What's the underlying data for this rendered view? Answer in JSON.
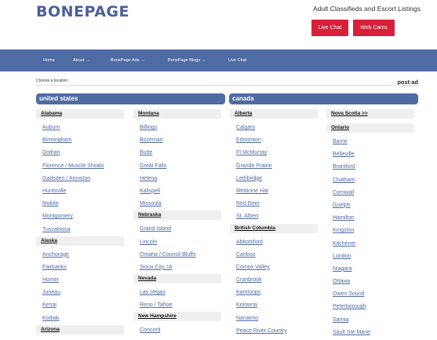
{
  "header": {
    "logo_text": "BONEPAGE",
    "tagline": "Adult Classifieds and Escort Listings",
    "live_chat_button": "Live Chat",
    "web_cams_button": "Web Cams"
  },
  "nav": {
    "items": [
      {
        "label": "Home",
        "dropdown": false
      },
      {
        "label": "About",
        "dropdown": true
      },
      {
        "label": "BonePage Ads",
        "dropdown": true
      },
      {
        "label": "BonePage Blogs",
        "dropdown": true
      },
      {
        "label": "Live Chat",
        "dropdown": false
      }
    ]
  },
  "location": {
    "choose_label": "Choose a location:",
    "post_ad": "post ad"
  },
  "countries": {
    "us": "united states",
    "canada": "canada"
  },
  "columns": [
    [
      {
        "region": "Alabama",
        "cities": [
          "Auburn",
          "Birmingham",
          "Dothan",
          "Florence / Muscle Shoals",
          "Gadsden / Anniston",
          "Huntsville",
          "Mobile",
          "Montgomery",
          "Tuscaloosa"
        ]
      },
      {
        "region": "Alaska",
        "cities": [
          "Anchorage",
          "Fairbanks",
          "Homer",
          "Juneau",
          "Kenai",
          "Kodiak"
        ]
      },
      {
        "region": "Arizona",
        "cities": []
      }
    ],
    [
      {
        "region": "Montana",
        "cities": [
          "Billings",
          "Bozeman",
          "Butte",
          "Great Falls",
          "Helena",
          "Kalispell",
          "Missoula"
        ]
      },
      {
        "region": "Nebraska",
        "cities": [
          "Grand Island",
          "Lincoln",
          "Omaha / Council Bluffs",
          "Sioux City, IA"
        ]
      },
      {
        "region": "Nevada",
        "cities": [
          "Las Vegas",
          "Reno / Tahoe"
        ]
      },
      {
        "region": "New Hampshire",
        "cities": [
          "Concord"
        ]
      }
    ],
    [
      {
        "region": "Alberta",
        "cities": [
          "Calgary",
          "Edmonton",
          "Ft McMurray",
          "Grande Prairie",
          "Lethbridge",
          "Medicine Hat",
          "Red Deer",
          "St. Albert"
        ]
      },
      {
        "region": "British Columbia",
        "cities": [
          "Abbotsford",
          "Cariboo",
          "Comox Valley",
          "Cranbrook",
          "Kamloops",
          "Kelowna",
          "Nanaimo",
          "Peace River Country"
        ]
      }
    ],
    [
      {
        "region": "Nova Scotia >>",
        "cities": []
      },
      {
        "region": "Ontario",
        "cities": [
          "Barrie",
          "Belleville",
          "Brantford",
          "Chatham",
          "Cornwall",
          "Guelph",
          "Hamilton",
          "Kingston",
          "Kitchener",
          "London",
          "Niagara",
          "Ottawa",
          "Owen Sound",
          "Peterborough",
          "Sarnia",
          "Sault Ste Marie"
        ]
      }
    ]
  ],
  "colors": {
    "brand_blue": "#4f6ba3",
    "button_red": "#d71f3a"
  }
}
